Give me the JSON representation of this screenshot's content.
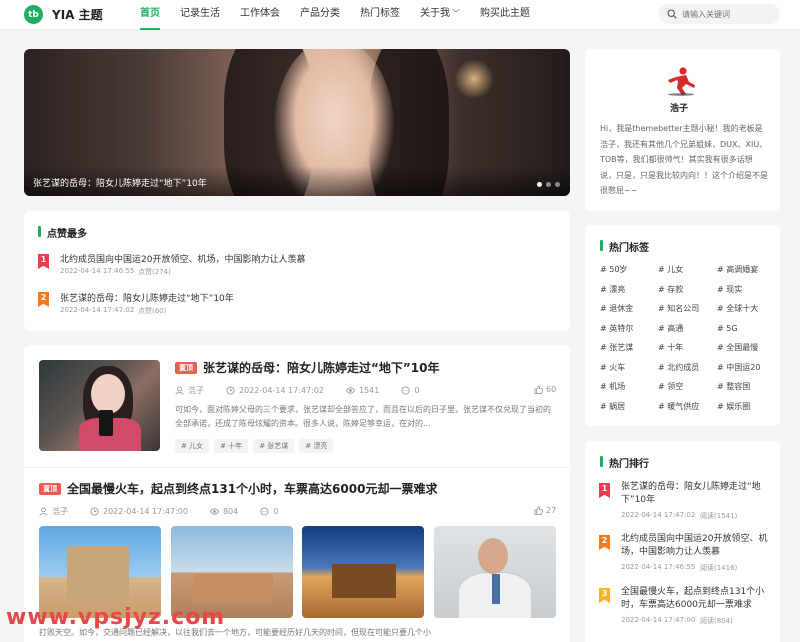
{
  "header": {
    "logo_badge": "tb",
    "logo_text": "YIA 主题",
    "nav": [
      {
        "label": "首页",
        "active": true
      },
      {
        "label": "记录生活"
      },
      {
        "label": "工作体会"
      },
      {
        "label": "产品分类"
      },
      {
        "label": "热门标签"
      },
      {
        "label": "关于我",
        "dropdown": true
      },
      {
        "label": "购买此主题"
      }
    ],
    "search_placeholder": "请输入关键词"
  },
  "hero": {
    "caption": "张艺谋的岳母：陪女儿陈婷走过“地下”10年"
  },
  "top_liked": {
    "title": "点赞最多",
    "items": [
      {
        "rank": "1",
        "title": "北约成员国向中国运20开放领空、机场，中国影响力让人羡慕",
        "date": "2022-04-14 17:46:55",
        "count": "点赞(274)"
      },
      {
        "rank": "2",
        "title": "张艺谋的岳母：陪女儿陈婷走过“地下”10年",
        "date": "2022-04-14 17:47:02",
        "count": "点赞(60)"
      }
    ]
  },
  "posts": [
    {
      "badge": "置顶",
      "title": "张艺谋的岳母：陪女儿陈婷走过“地下”10年",
      "author": "浩子",
      "date": "2022-04-14 17:47:02",
      "views": "1541",
      "comments": "0",
      "likes": "60",
      "excerpt": "可如今，面对陈婷父母的三个要求，张艺谋却全部答应了，而且在以后的日子里，张艺谋不仅兑现了当初的全部承诺，还成了陈母炫耀的资本。很多人说，陈婷足够幸运，在对的...",
      "tags": [
        "# 儿女",
        "# 十年",
        "# 张艺谋",
        "# 漂亮"
      ]
    },
    {
      "badge": "置顶",
      "title": "全国最慢火车，起点到终点131个小时，车票高达6000元却一票难求",
      "author": "浩子",
      "date": "2022-04-14 17:47:00",
      "views": "804",
      "comments": "0",
      "likes": "27",
      "excerpt": "打败天空。如今，交通问题已经解决，以往我们去一个地方，可能要经历好几天的时间，但现在可能只要几个小"
    }
  ],
  "profile": {
    "name": "浩子",
    "bio": "Hi，我是themebetter主题小秘！我的老板是浩子，我还有其他几个兄弟姐妹，DUX、XIU、TOB等，我们都很帅气！其实我有很多话想说，只是，只是我比较内向！！这个介绍是不是很憋屈~~"
  },
  "hot_tags": {
    "title": "热门标签",
    "tags": [
      "# 50岁",
      "# 儿女",
      "# 高调婚宴",
      "# 漂亮",
      "# 存款",
      "# 现实",
      "# 退休金",
      "# 知名公司",
      "# 全球十大",
      "# 英特尔",
      "# 高通",
      "# 5G",
      "# 张艺谋",
      "# 十年",
      "# 全国最慢",
      "# 火车",
      "# 北约成员",
      "# 中国运20",
      "# 机场",
      "# 领空",
      "# 整容国",
      "# 蜗居",
      "# 暖气供应",
      "# 娱乐圈"
    ]
  },
  "hot_rank": {
    "title": "热门排行",
    "items": [
      {
        "rank": "1",
        "title": "张艺谋的岳母：陪女儿陈婷走过“地下”10年",
        "date": "2022-04-14 17:47:02",
        "reads": "阅读(1541)"
      },
      {
        "rank": "2",
        "title": "北约成员国向中国运20开放领空、机场，中国影响力让人羡慕",
        "date": "2022-04-14 17:46:55",
        "reads": "阅读(1416)"
      },
      {
        "rank": "3",
        "title": "全国最慢火车，起点到终点131个小时，车票高达6000元却一票难求",
        "date": "2022-04-14 17:47:00",
        "reads": "阅读(804)"
      }
    ]
  },
  "watermark": "www.vpsjyz.com",
  "colors": {
    "accent": "#21ad5f",
    "hot": "#f05b52",
    "rank1": "#ec3b4a",
    "rank2": "#f7791f",
    "rank3": "#f7b51f"
  }
}
